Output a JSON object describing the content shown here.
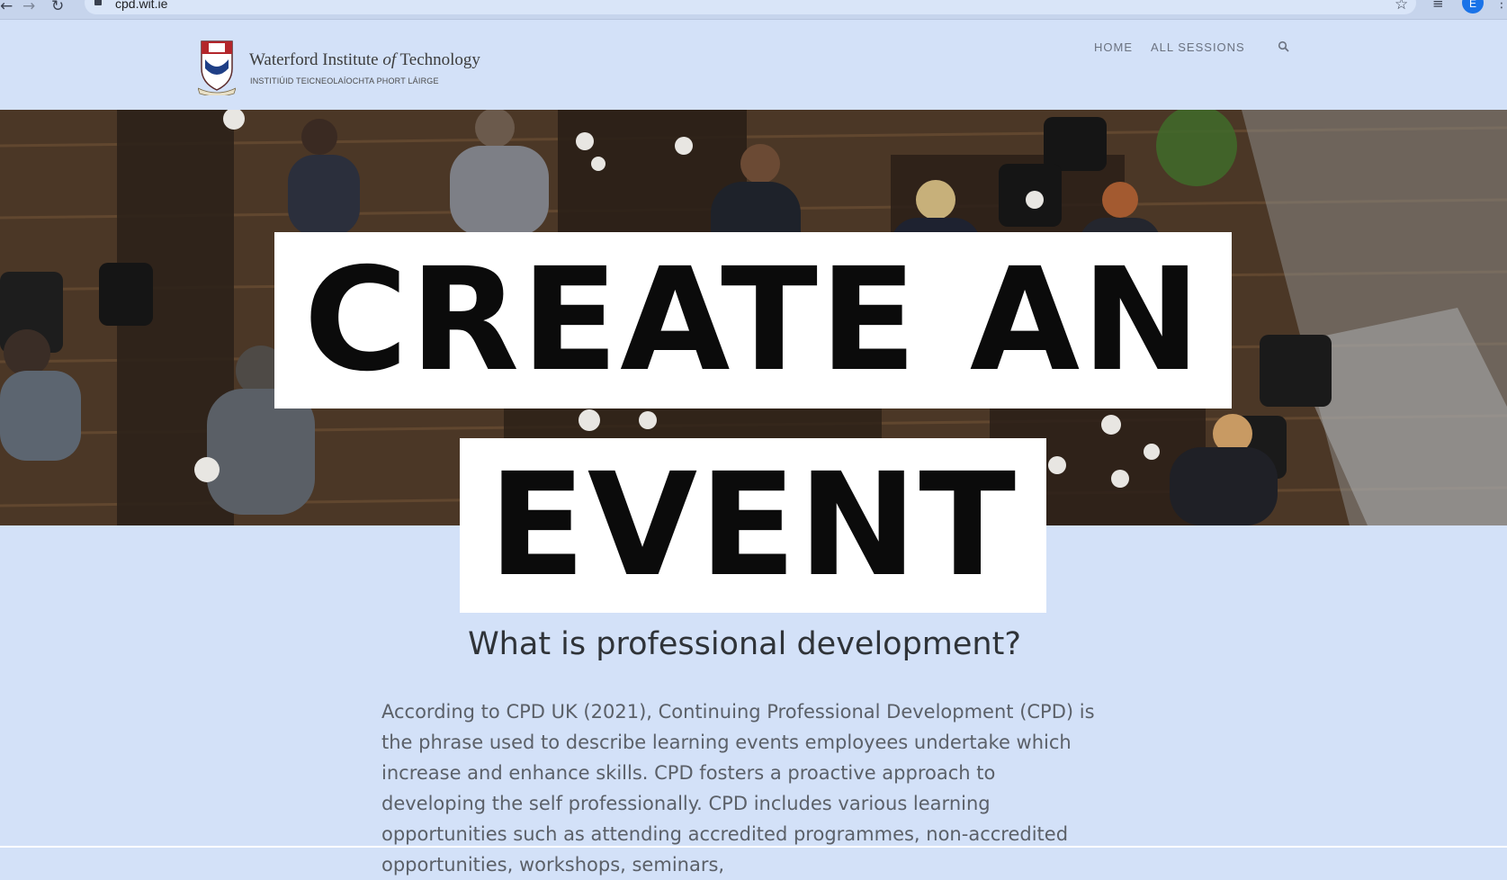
{
  "browser": {
    "url": "cpd.wit.ie",
    "profile_initial": "E",
    "icons": [
      "back-icon",
      "forward-icon",
      "reload-icon",
      "lock-icon",
      "star-icon",
      "playlist-icon",
      "kebab-menu-icon"
    ]
  },
  "header": {
    "logo_title_main": "Waterford Institute ",
    "logo_title_italic": "of",
    "logo_title_end": " Technology",
    "logo_subtitle": "INSTITIÚID TEICNEOLAÍOCHTA PHORT LÁIRGE",
    "nav": [
      {
        "label": "HOME"
      },
      {
        "label": "ALL SESSIONS"
      }
    ],
    "search_icon": "search-icon"
  },
  "overlay": {
    "line1": "CREATE AN",
    "line2": "EVENT"
  },
  "content": {
    "heading": "What is professional development?",
    "paragraph": "According to CPD UK (2021), Continuing Professional Development (CPD) is the phrase used to describe learning events employees undertake which increase and enhance skills. CPD fosters a proactive approach to developing the self professionally. CPD includes various learning opportunities such as attending accredited programmes, non-accredited opportunities, workshops, seminars,"
  },
  "colors": {
    "page_bg": "#d3e1f8",
    "title_box": "#ffffff",
    "title_text": "#0b0b0b"
  }
}
